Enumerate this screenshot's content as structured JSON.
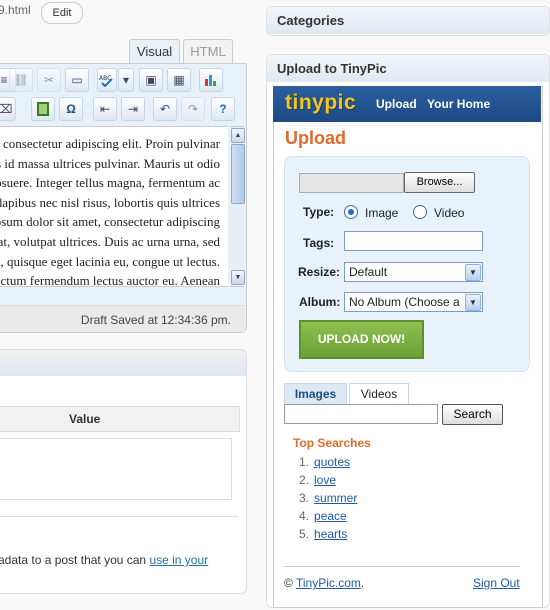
{
  "header": {
    "permalink_tail": "9.html",
    "edit_label": "Edit"
  },
  "editor": {
    "tabs": [
      "Visual",
      "HTML"
    ],
    "content_lines": [
      "Lorem ipsum dolor sit amet, consectetur adipiscing elit. Proin pulvinar",
      "Sed ut risus id massa ultrices pulvinar. Mauris ut odio",
      "vitae nunc posuere. Integer tellus magna, fermentum ac",
      "pretium a, dapibus nec nisl risus, lobortis quis ultrices",
      "Praesent lorem ipsum dolor sit amet, consectetur adipiscing",
      "tempor at, volutpat ultrices. Duis ac urna urna, sed",
      "viverra nulla, quisque eget lacinia eu, congue ut lectus.",
      "Aliquam vel, dictum fermendum lectus auctor eu. Aenean"
    ],
    "draft_status": "Draft Saved at 12:34:36 pm."
  },
  "custom_fields": {
    "value_header": "Value",
    "description_prefix": "adata to a post that you can ",
    "description_link": "use in your"
  },
  "sidebar": {
    "categories_title": "Categories",
    "tinypic_title": "Upload to TinyPic",
    "tinypic": {
      "logo": "tinypic",
      "nav": [
        "Upload",
        "Your Home"
      ],
      "heading": "Upload",
      "browse_label": "Browse...",
      "type_label": "Type:",
      "type_options": [
        "Image",
        "Video"
      ],
      "type_selected": "Image",
      "tags_label": "Tags:",
      "resize_label": "Resize:",
      "resize_value": "Default",
      "album_label": "Album:",
      "album_value": "No Album (Choose a",
      "upload_button": "UPLOAD NOW!",
      "search_tabs": [
        "Images",
        "Videos"
      ],
      "search_button": "Search",
      "top_searches_title": "Top Searches",
      "top_searches": [
        {
          "num": "1.",
          "term": "quotes"
        },
        {
          "num": "2.",
          "term": "love"
        },
        {
          "num": "3.",
          "term": "summer"
        },
        {
          "num": "4.",
          "term": "peace"
        },
        {
          "num": "5.",
          "term": "hearts"
        }
      ],
      "copyright_symbol": "©",
      "copyright_link": "TinyPic.com",
      "copyright_period": ".",
      "sign_out": "Sign Out"
    }
  },
  "colors": {
    "accent_orange": "#e06a2a",
    "tinypic_blue": "#2c5e9e",
    "upload_green": "#7cb143",
    "link_blue": "#1f5aa8"
  }
}
